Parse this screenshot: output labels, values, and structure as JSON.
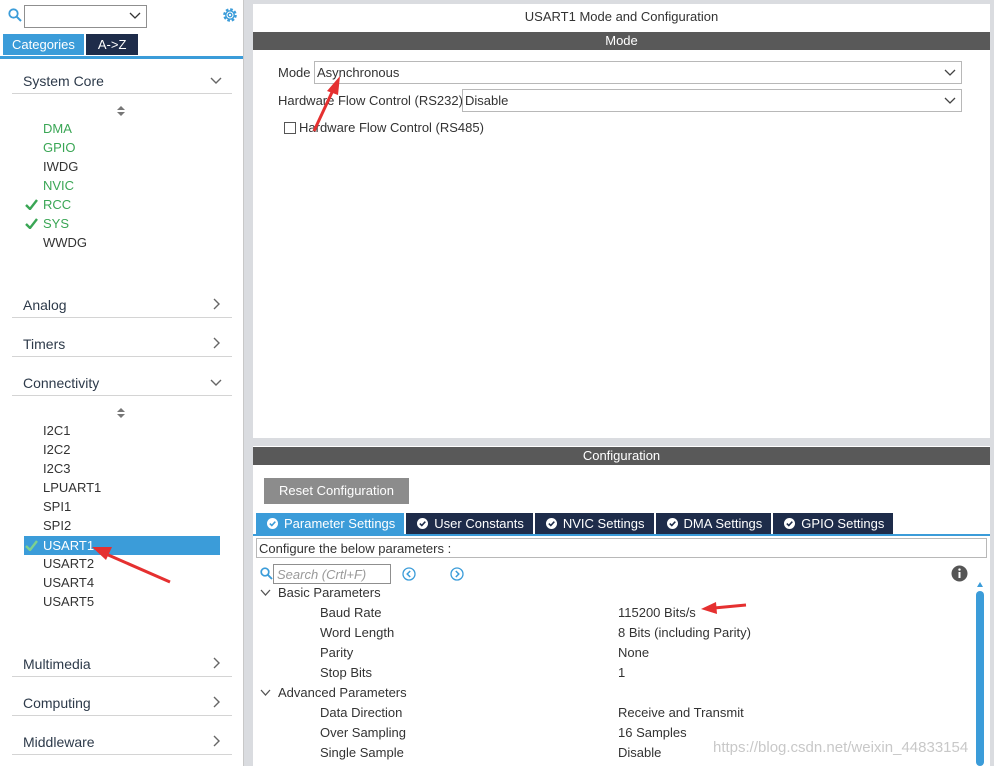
{
  "left_panel": {
    "search_value": "",
    "tabs": [
      {
        "label": "Categories",
        "active": true
      },
      {
        "label": "A->Z",
        "active": false
      }
    ],
    "sections": {
      "system_core": {
        "label": "System Core",
        "expanded": true,
        "items": [
          {
            "label": "DMA",
            "style": "green",
            "checked": false
          },
          {
            "label": "GPIO",
            "style": "green",
            "checked": false
          },
          {
            "label": "IWDG",
            "style": "plain",
            "checked": false
          },
          {
            "label": "NVIC",
            "style": "green",
            "checked": false
          },
          {
            "label": "RCC",
            "style": "green",
            "checked": true
          },
          {
            "label": "SYS",
            "style": "green",
            "checked": true
          },
          {
            "label": "WWDG",
            "style": "plain",
            "checked": false
          }
        ]
      },
      "analog": {
        "label": "Analog",
        "expanded": false
      },
      "timers": {
        "label": "Timers",
        "expanded": false
      },
      "connectivity": {
        "label": "Connectivity",
        "expanded": true,
        "items": [
          {
            "label": "I2C1",
            "style": "plain"
          },
          {
            "label": "I2C2",
            "style": "plain"
          },
          {
            "label": "I2C3",
            "style": "plain"
          },
          {
            "label": "LPUART1",
            "style": "plain"
          },
          {
            "label": "SPI1",
            "style": "plain"
          },
          {
            "label": "SPI2",
            "style": "plain"
          },
          {
            "label": "USART1",
            "style": "selected",
            "checked": true
          },
          {
            "label": "USART2",
            "style": "plain"
          },
          {
            "label": "USART4",
            "style": "plain"
          },
          {
            "label": "USART5",
            "style": "plain"
          }
        ]
      },
      "multimedia": {
        "label": "Multimedia",
        "expanded": false
      },
      "computing": {
        "label": "Computing",
        "expanded": false
      },
      "middleware": {
        "label": "Middleware",
        "expanded": false
      }
    }
  },
  "mode_panel": {
    "title": "USART1 Mode and Configuration",
    "section_bar": "Mode",
    "mode": {
      "label": "Mode",
      "value": "Asynchronous"
    },
    "hw_flow_rs232": {
      "label": "Hardware Flow Control (RS232)",
      "value": "Disable"
    },
    "hw_flow_rs485": {
      "label": "Hardware Flow Control (RS485)",
      "checked": false
    }
  },
  "config_panel": {
    "section_bar": "Configuration",
    "reset_button": "Reset Configuration",
    "tabs": [
      {
        "label": "Parameter Settings",
        "active": true
      },
      {
        "label": "User Constants",
        "active": false
      },
      {
        "label": "NVIC Settings",
        "active": false
      },
      {
        "label": "DMA Settings",
        "active": false
      },
      {
        "label": "GPIO Settings",
        "active": false
      }
    ],
    "description": "Configure the below parameters :",
    "search_placeholder": "Search (Crtl+F)",
    "groups": [
      {
        "label": "Basic Parameters",
        "params": [
          {
            "name": "Baud Rate",
            "value": "115200 Bits/s"
          },
          {
            "name": "Word Length",
            "value": "8 Bits (including Parity)"
          },
          {
            "name": "Parity",
            "value": "None"
          },
          {
            "name": "Stop Bits",
            "value": "1"
          }
        ]
      },
      {
        "label": "Advanced Parameters",
        "params": [
          {
            "name": "Data Direction",
            "value": "Receive and Transmit"
          },
          {
            "name": "Over Sampling",
            "value": "16 Samples"
          },
          {
            "name": "Single Sample",
            "value": "Disable"
          }
        ]
      }
    ]
  },
  "watermark": "https://blog.csdn.net/weixin_44833154",
  "colors": {
    "accent_blue": "#3b9cd9",
    "dark_navy": "#1e2c4a",
    "bar_gray": "#595959",
    "enabled_green": "#3aa655",
    "annotation_red": "#e53030"
  }
}
